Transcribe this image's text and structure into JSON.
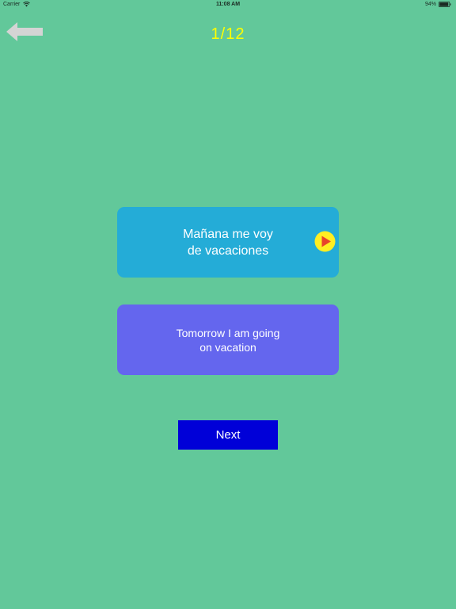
{
  "status_bar": {
    "carrier": "Carrier",
    "time": "11:08 AM",
    "battery": "94%",
    "battery_level": 0.94
  },
  "header": {
    "back_icon": "arrow-left-icon",
    "progress": "1/12"
  },
  "card_spanish": {
    "line1": "Mañana me voy",
    "line2": "de vacaciones",
    "play_icon": "play-icon"
  },
  "card_english": {
    "line1": "Tomorrow I am going",
    "line2": "on vacation"
  },
  "actions": {
    "next_label": "Next"
  },
  "colors": {
    "background": "#62c89a",
    "progress": "#ffff00",
    "spanish_card": "#24acd7",
    "english_card": "#6466ee",
    "next_button": "#0000d8",
    "play_circle": "#ffee22",
    "play_triangle": "#e8432a"
  }
}
